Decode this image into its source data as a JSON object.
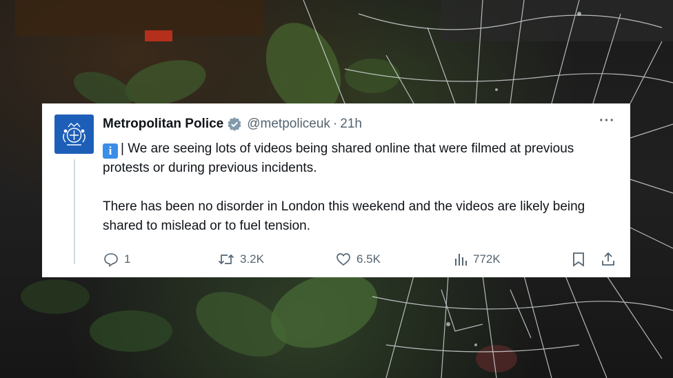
{
  "tweet": {
    "display_name": "Metropolitan Police",
    "handle": "@metpoliceuk",
    "separator": "·",
    "time": "21h",
    "more_label": "···",
    "info_badge": "i",
    "paragraph_1": "| We are seeing lots of videos being shared online that were filmed at previous protests or during previous incidents.",
    "paragraph_2": "There has been no disorder in London this weekend and the videos are likely being shared to mislead or to fuel tension.",
    "verified_color": "#829aab",
    "accent_color": "#3b8ee8"
  },
  "actions": {
    "reply_icon": "reply-icon",
    "reply_count": "1",
    "retweet_icon": "retweet-icon",
    "retweet_count": "3.2K",
    "like_icon": "heart-icon",
    "like_count": "6.5K",
    "views_icon": "analytics-icon",
    "views_count": "772K",
    "bookmark_icon": "bookmark-icon",
    "share_icon": "share-icon"
  }
}
